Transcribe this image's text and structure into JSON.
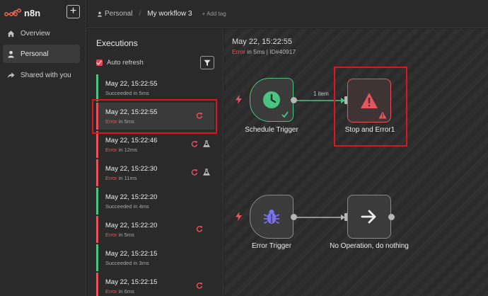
{
  "app": {
    "logo_text": "n8n",
    "new_label": "+"
  },
  "sidebar": {
    "items": [
      {
        "label": "Overview",
        "icon": "home-icon"
      },
      {
        "label": "Personal",
        "icon": "user-icon"
      },
      {
        "label": "Shared with you",
        "icon": "share-icon"
      }
    ]
  },
  "header": {
    "project": "Personal",
    "workflow": "My workflow 3",
    "add_tag": "+ Add tag"
  },
  "executions": {
    "title": "Executions",
    "auto_refresh_label": "Auto refresh",
    "auto_refresh_checked": true,
    "items": [
      {
        "date": "May 22, 15:22:55",
        "status": "Succeeded",
        "duration": "in 5ms",
        "state": "success"
      },
      {
        "date": "May 22, 15:22:55",
        "status": "Error",
        "duration": "in 5ms",
        "state": "error"
      },
      {
        "date": "May 22, 15:22:46",
        "status": "Error",
        "duration": "in 12ms",
        "state": "error"
      },
      {
        "date": "May 22, 15:22:30",
        "status": "Error",
        "duration": "in 11ms",
        "state": "error"
      },
      {
        "date": "May 22, 15:22:20",
        "status": "Succeeded",
        "duration": "in 4ms",
        "state": "success"
      },
      {
        "date": "May 22, 15:22:20",
        "status": "Error",
        "duration": "in 5ms",
        "state": "error"
      },
      {
        "date": "May 22, 15:22:15",
        "status": "Succeeded",
        "duration": "in 3ms",
        "state": "success"
      },
      {
        "date": "May 22, 15:22:15",
        "status": "Error",
        "duration": "in 6ms",
        "state": "error"
      }
    ]
  },
  "canvas": {
    "run_date": "May 22, 15:22:55",
    "run_status": "Error",
    "run_duration": "in 5ms",
    "run_id": "ID#40917",
    "connection_label": "1 item",
    "nodes": {
      "schedule_trigger": "Schedule Trigger",
      "stop_and_error": "Stop and Error1",
      "error_trigger": "Error Trigger",
      "no_op": "No Operation, do nothing"
    }
  },
  "colors": {
    "success": "#49c481",
    "error": "#e8545b",
    "highlight": "#e0141d",
    "accent": "#ff6d5a"
  }
}
